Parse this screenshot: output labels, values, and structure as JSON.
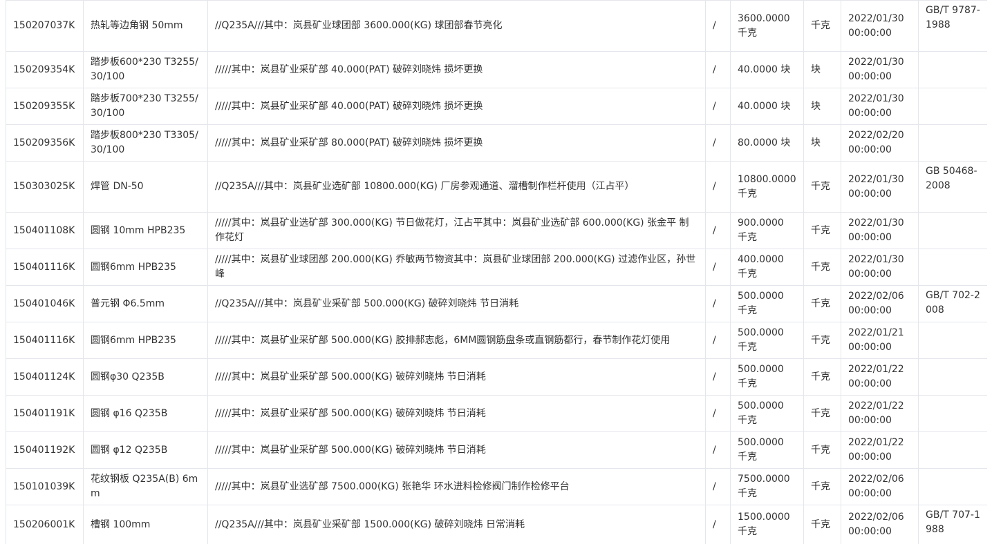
{
  "table": {
    "rows": [
      {
        "code": "150207037K",
        "name": "热轧等边角钢 50mm",
        "desc": "//Q235A///其中：岚县矿业球团部 3600.000(KG) 球团部春节亮化",
        "sep": "/",
        "qty": "3600.0000 千克",
        "unit": "千克",
        "date": "2022/01/30 00:00:00",
        "standard": "GB/T 9787-1988"
      },
      {
        "code": "150209354K",
        "name": "踏步板600*230 T3255/30/100",
        "desc": "/////其中：岚县矿业采矿部 40.000(PAT) 破碎刘晓炜 损坏更换",
        "sep": "/",
        "qty": "40.0000 块",
        "unit": "块",
        "date": "2022/01/30 00:00:00",
        "standard": ""
      },
      {
        "code": "150209355K",
        "name": "踏步板700*230 T3255/30/100",
        "desc": "/////其中：岚县矿业采矿部 40.000(PAT) 破碎刘晓炜 损坏更换",
        "sep": "/",
        "qty": "40.0000 块",
        "unit": "块",
        "date": "2022/01/30 00:00:00",
        "standard": ""
      },
      {
        "code": "150209356K",
        "name": "踏步板800*230 T3305/30/100",
        "desc": "/////其中：岚县矿业采矿部 80.000(PAT) 破碎刘晓炜 损坏更换",
        "sep": "/",
        "qty": "80.0000 块",
        "unit": "块",
        "date": "2022/02/20 00:00:00",
        "standard": ""
      },
      {
        "code": "150303025K",
        "name": "焊管 DN-50",
        "desc": "//Q235A///其中：岚县矿业选矿部 10800.000(KG) 厂房参观通道、溜槽制作栏杆使用（江占平）",
        "sep": "/",
        "qty": "10800.0000 千克",
        "unit": "千克",
        "date": "2022/01/30 00:00:00",
        "standard": "GB 50468-2008"
      },
      {
        "code": "150401108K",
        "name": "圆钢 10mm HPB235",
        "desc": "/////其中：岚县矿业选矿部 300.000(KG) 节日做花灯，江占平其中：岚县矿业选矿部 600.000(KG) 张金平 制作花灯",
        "sep": "/",
        "qty": "900.0000 千克",
        "unit": "千克",
        "date": "2022/01/30 00:00:00",
        "standard": ""
      },
      {
        "code": "150401116K",
        "name": "圆钢6mm HPB235",
        "desc": "/////其中：岚县矿业球团部 200.000(KG) 乔敏两节物资其中：岚县矿业球团部 200.000(KG) 过滤作业区，孙世峰",
        "sep": "/",
        "qty": "400.0000 千克",
        "unit": "千克",
        "date": "2022/01/30 00:00:00",
        "standard": ""
      },
      {
        "code": "150401046K",
        "name": "普元钢 Φ6.5mm",
        "desc": "//Q235A///其中：岚县矿业采矿部 500.000(KG) 破碎刘晓炜 节日消耗",
        "sep": "/",
        "qty": "500.0000 千克",
        "unit": "千克",
        "date": "2022/02/06 00:00:00",
        "standard": "GB/T 702-2008"
      },
      {
        "code": "150401116K",
        "name": "圆钢6mm HPB235",
        "desc": "/////其中：岚县矿业采矿部 500.000(KG) 胶排郝志彪，6MM圆钢筋盘条或直钢筋都行，春节制作花灯使用",
        "sep": "/",
        "qty": "500.0000 千克",
        "unit": "千克",
        "date": "2022/01/21 00:00:00",
        "standard": ""
      },
      {
        "code": "150401124K",
        "name": "圆钢φ30 Q235B",
        "desc": "/////其中：岚县矿业采矿部 500.000(KG) 破碎刘晓炜 节日消耗",
        "sep": "/",
        "qty": "500.0000 千克",
        "unit": "千克",
        "date": "2022/01/22 00:00:00",
        "standard": ""
      },
      {
        "code": "150401191K",
        "name": "圆钢 φ16 Q235B",
        "desc": "/////其中：岚县矿业采矿部 500.000(KG) 破碎刘晓炜 节日消耗",
        "sep": "/",
        "qty": "500.0000 千克",
        "unit": "千克",
        "date": "2022/01/22 00:00:00",
        "standard": ""
      },
      {
        "code": "150401192K",
        "name": "圆钢 φ12 Q235B",
        "desc": "/////其中：岚县矿业采矿部 500.000(KG) 破碎刘晓炜 节日消耗",
        "sep": "/",
        "qty": "500.0000 千克",
        "unit": "千克",
        "date": "2022/01/22 00:00:00",
        "standard": ""
      },
      {
        "code": "150101039K",
        "name": "花纹钢板 Q235A(B) 6mm",
        "desc": "/////其中：岚县矿业选矿部 7500.000(KG) 张艳华 环水进料检修阀门制作检修平台",
        "sep": "/",
        "qty": "7500.0000 千克",
        "unit": "千克",
        "date": "2022/02/06 00:00:00",
        "standard": ""
      },
      {
        "code": "150206001K",
        "name": "槽钢 100mm",
        "desc": "//Q235A///其中：岚县矿业采矿部 1500.000(KG) 破碎刘晓炜 日常消耗",
        "sep": "/",
        "qty": "1500.0000 千克",
        "unit": "千克",
        "date": "2022/02/06 00:00:00",
        "standard": "GB/T 707-1988"
      }
    ]
  }
}
